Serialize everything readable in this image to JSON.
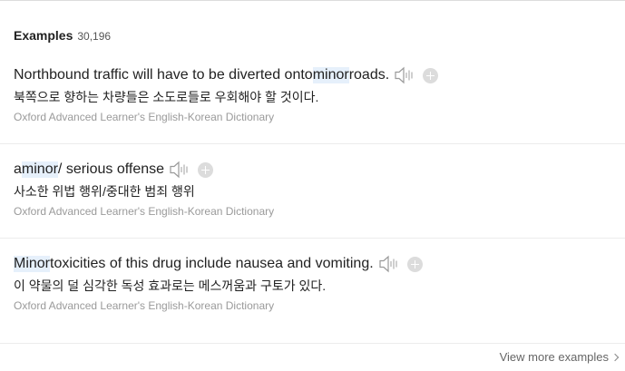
{
  "section": {
    "title": "Examples",
    "count": "30,196"
  },
  "examples": [
    {
      "pre": "Northbound traffic will have to be diverted onto ",
      "highlight": "minor",
      "post": " roads.",
      "translation": "북쪽으로 향하는 차량들은 소도로들로 우회해야 할 것이다.",
      "source": "Oxford Advanced Learner's English-Korean Dictionary"
    },
    {
      "pre": "a ",
      "highlight": "minor",
      "post": " / serious offense",
      "translation": "사소한 위법 행위/중대한 범죄 행위",
      "source": "Oxford Advanced Learner's English-Korean Dictionary"
    },
    {
      "pre": "",
      "highlight": "Minor",
      "post": " toxicities of this drug include nausea and vomiting.",
      "translation": "이 약물의 덜 심각한 독성 효과로는 메스꺼움과 구토가 있다.",
      "source": "Oxford Advanced Learner's English-Korean Dictionary"
    }
  ],
  "footer": {
    "view_more_label": "View more examples"
  },
  "icons": {
    "speaker": "speaker-icon",
    "add": "plus-circle-icon",
    "chevron": "chevron-right-icon"
  },
  "colors": {
    "highlight": "#e6f0fb",
    "source_text": "#9a9a9a",
    "icon_gray": "#b5b5b5"
  }
}
